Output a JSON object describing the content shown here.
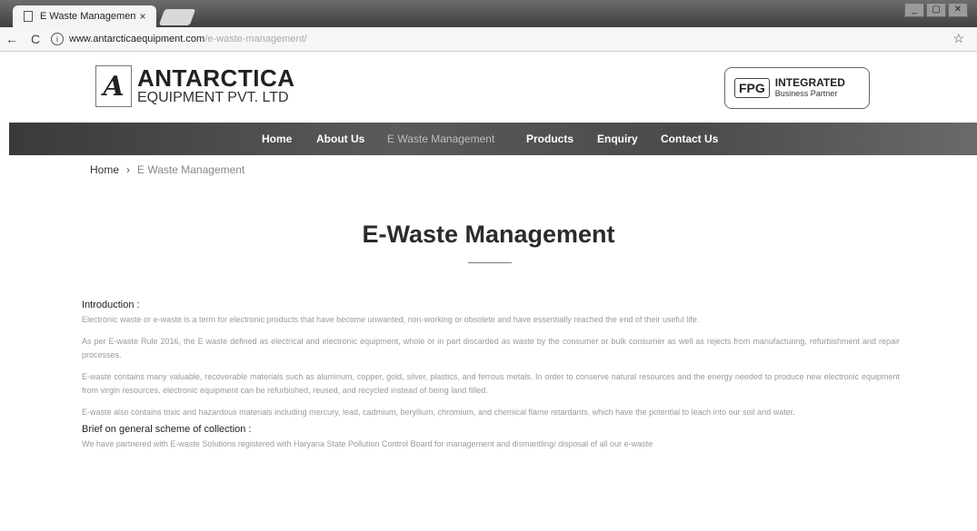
{
  "browser": {
    "tab_title": "E Waste Management",
    "tab_close": "×",
    "url_host": "www.antarcticaequipment.com",
    "url_path": "/e-waste-management/",
    "window_controls": [
      "_",
      "▢",
      "✕"
    ]
  },
  "header": {
    "logo_letter": "A",
    "company_name": "ANTARCTICA",
    "company_sub": "EQUIPMENT PVT. LTD",
    "partner_badge": "FPG",
    "partner_line1": "INTEGRATED",
    "partner_line2": "Business Partner"
  },
  "nav": {
    "items": [
      {
        "label": "Home"
      },
      {
        "label": "About Us"
      },
      {
        "label": "E Waste Management"
      },
      {
        "label": "Products"
      },
      {
        "label": "Enquiry"
      },
      {
        "label": "Contact Us"
      }
    ]
  },
  "breadcrumb": {
    "home": "Home",
    "separator": "›",
    "current": "E Waste Management"
  },
  "page": {
    "title": "E-Waste Management"
  },
  "content": {
    "intro_heading": "Introduction :",
    "intro_paragraphs": [
      "Electronic waste or e-waste is a term for electronic products that have become unwanted, non-working or obsolete and have essentially reached the end of their useful life.",
      "As per E-waste Rule 2016, the E waste defined as electrical and electronic equipment, whole or in part discarded as waste by the consumer or bulk consumer as well as rejects from manufacturing, refurbishment and repair processes.",
      "E-waste contains many valuable, recoverable materials such as aluminum, copper, gold, silver, plastics, and ferrous metals. In order to conserve natural resources and the energy needed to produce new electronic equipment from virgin resources, electronic equipment can be refurbished, reused, and recycled instead of being land filled.",
      "E-waste also contains toxic and hazardous materials including mercury, lead, cadmium, beryllium, chromium, and chemical flame retardants, which have the potential to leach into our soil and water."
    ],
    "scheme_heading": "Brief on general scheme of collection :",
    "scheme_paragraph": "We have partnered with E-waste Solutions registered with Haryana State Pollution Control Board for management and dismantling/ disposal of all our e-waste"
  }
}
